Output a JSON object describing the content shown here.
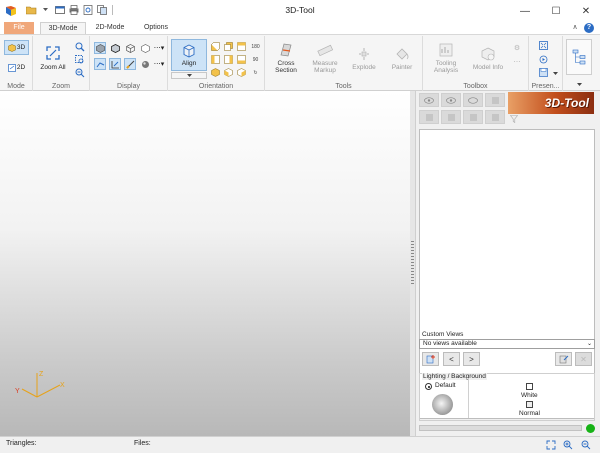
{
  "window": {
    "title": "3D-Tool",
    "minimize": "—",
    "maximize": "☐",
    "close": "✕"
  },
  "tabs": [
    {
      "label": "File"
    },
    {
      "label": "3D-Mode"
    },
    {
      "label": "2D-Mode"
    },
    {
      "label": "Options"
    }
  ],
  "ribbon": {
    "mode": {
      "btn3d": "3D",
      "btn2d": "2D",
      "group": "Mode"
    },
    "zoom": {
      "zoom_all": "Zoom All",
      "group": "Zoom"
    },
    "display": {
      "group": "Display"
    },
    "orientation": {
      "align": "Align",
      "group": "Orientation"
    },
    "tools": {
      "cross_section": "Cross Section",
      "measure_markup": "Measure Markup",
      "explode": "Explode",
      "painter": "Painter",
      "group": "Tools"
    },
    "toolbox": {
      "tooling_analysis": "Tooling Analysis",
      "model_info": "Model Info",
      "group": "Toolbox"
    },
    "presentation": {
      "group": "Presen..."
    }
  },
  "panel": {
    "logo": "3D-Tool",
    "custom_views": {
      "label": "Custom Views",
      "value": "No views available"
    },
    "lighting": {
      "label": "Lighting / Background",
      "default_label": "Default",
      "white_label": "White",
      "normal_label": "Normal"
    }
  },
  "statusbar": {
    "triangles": "Triangles:",
    "files": "Files:"
  },
  "colors": {
    "file_tab": "#f0a77a",
    "logo": "#c24e1c",
    "status_ok": "#17b317",
    "accent": "#2b6cc4"
  }
}
